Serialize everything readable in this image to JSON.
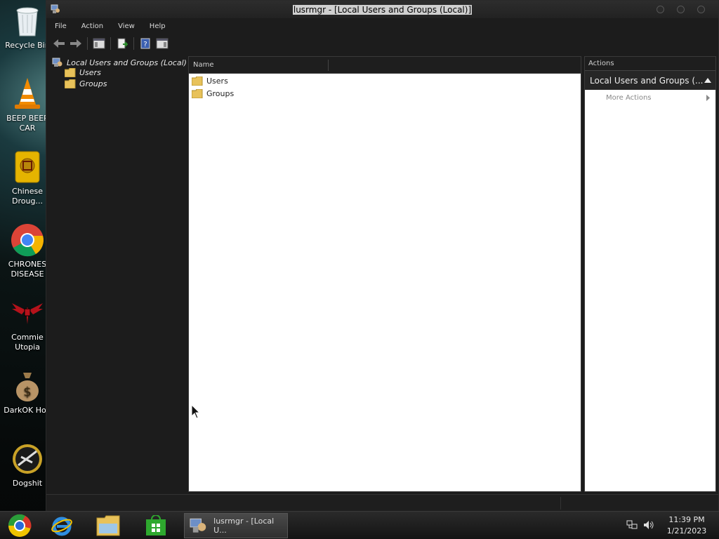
{
  "desktop": {
    "icons": [
      {
        "label": "Recycle Bin"
      },
      {
        "label": "BEEP BEEP CAR"
      },
      {
        "label": "Chinese Droug..."
      },
      {
        "label": "CHRONES DISEASE"
      },
      {
        "label": "Commie Utopia"
      },
      {
        "label": "DarkOK Hon"
      },
      {
        "label": "Dogshit"
      }
    ]
  },
  "window": {
    "title": "lusrmgr - [Local Users and Groups (Local)]",
    "menu": [
      "File",
      "Action",
      "View",
      "Help"
    ],
    "tree": {
      "root": "Local Users and Groups (Local)",
      "children": [
        "Users",
        "Groups"
      ]
    },
    "list": {
      "column_header": "Name",
      "rows": [
        "Users",
        "Groups"
      ]
    },
    "actions": {
      "header": "Actions",
      "section": "Local Users and Groups (...",
      "more": "More Actions"
    }
  },
  "taskbar": {
    "task_label": "lusrmgr - [Local U...",
    "time": "11:39 PM",
    "date": "1/21/2023"
  }
}
